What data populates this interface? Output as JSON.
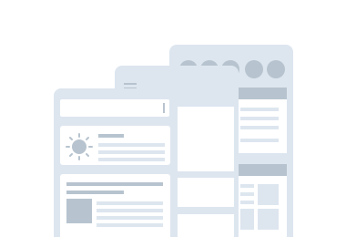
{
  "illustration": {
    "kind": "layered-windows",
    "colors": {
      "frame": "#dde6ef",
      "accent": "#b7c4cf",
      "content": "#ffffff"
    },
    "icons": [
      "sun-icon",
      "image-placeholder-icon",
      "hamburger-icon",
      "text-cursor-icon"
    ],
    "back_window": {
      "toolbar_circles": 5
    },
    "middle_window": {
      "menu_lines": 2
    },
    "front_window": {
      "cards": 2
    }
  }
}
